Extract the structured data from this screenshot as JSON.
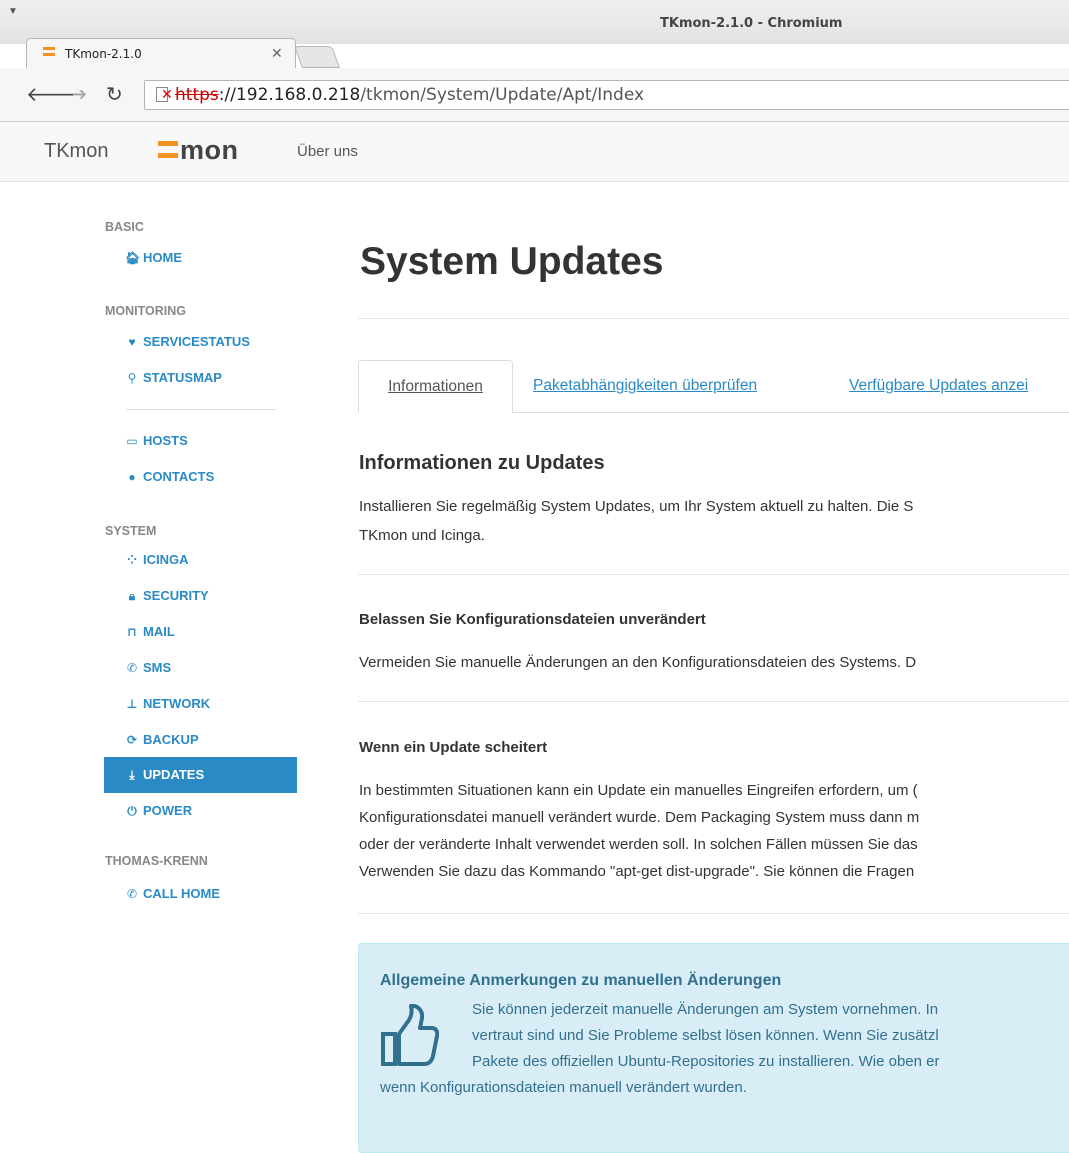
{
  "browser": {
    "window_title": "TKmon-2.1.0 - Chromium",
    "tab_title": "TKmon-2.1.0",
    "url_scheme": "https",
    "url_host": "://192.168.0.218",
    "url_path": "/tkmon/System/Update/Apt/Index"
  },
  "navbar": {
    "brand": "TKmon",
    "logo_text": "mon",
    "link_about": "Über uns"
  },
  "sidebar": {
    "sections": {
      "basic": "BASIC",
      "monitoring": "MONITORING",
      "system": "SYSTEM",
      "thomas_krenn": "THOMAS-KRENN"
    },
    "items": {
      "home": "HOME",
      "servicestatus": "SERVICESTATUS",
      "statusmap": "STATUSMAP",
      "hosts": "HOSTS",
      "contacts": "CONTACTS",
      "icinga": "ICINGA",
      "security": "SECURITY",
      "mail": "MAIL",
      "sms": "SMS",
      "network": "NETWORK",
      "backup": "BACKUP",
      "updates": "UPDATES",
      "power": "POWER",
      "call_home": "CALL HOME"
    },
    "active_item": "updates"
  },
  "main": {
    "title": "System Updates",
    "tabs": {
      "informationen": "Informationen",
      "paket": "Paketabhängigkeiten überprüfen",
      "verfuegbar": "Verfügbare Updates anzei"
    },
    "info_heading": "Informationen zu Updates",
    "info_line1": "Installieren Sie regelmäßig System Updates, um Ihr System aktuell zu halten. Die S",
    "info_line2": "TKmon und Icinga.",
    "belassen_heading": "Belassen Sie Konfigurationsdateien unverändert",
    "belassen_text": "Vermeiden Sie manuelle Änderungen an den Konfigurationsdateien des Systems. D",
    "scheitert_heading": "Wenn ein Update scheitert",
    "scheitert_line1": "In bestimmten Situationen kann ein Update ein manuelles Eingreifen erfordern, um (",
    "scheitert_line2": "Konfigurationsdatei manuell verändert wurde. Dem Packaging System muss dann m",
    "scheitert_line3": "oder der veränderte Inhalt verwendet werden soll. In solchen Fällen müssen Sie das",
    "scheitert_line4": "Verwenden Sie dazu das Kommando \"apt-get dist-upgrade\". Sie können die Fragen",
    "alert": {
      "title": "Allgemeine Anmerkungen zu manuellen Änderungen",
      "line1": "Sie können jederzeit manuelle Änderungen am System vornehmen. In",
      "line2": "vertraut sind und Sie Probleme selbst lösen können. Wenn Sie zusätzl",
      "line3": "Pakete des offiziellen Ubuntu-Repositories zu installieren. Wie oben er",
      "line4": "wenn Konfigurationsdateien manuell verändert wurden."
    }
  },
  "colors": {
    "link": "#2a8ac6",
    "logo_orange": "#f39221",
    "alert_bg": "#d9edf7",
    "alert_text": "#31708f"
  }
}
